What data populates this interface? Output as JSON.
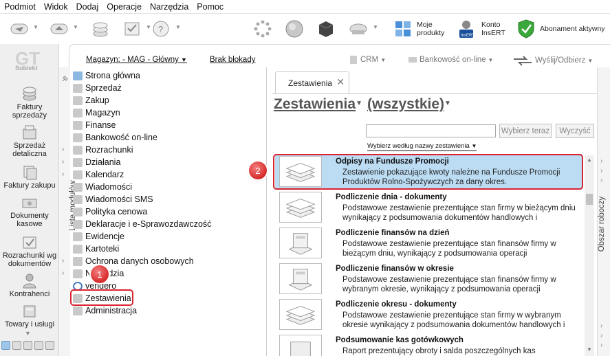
{
  "menu": [
    "Podmiot",
    "Widok",
    "Dodaj",
    "Operacje",
    "Narzędzia",
    "Pomoc"
  ],
  "toolbar": {
    "my_products": "Moje\nprodukty",
    "account": "Konto\nInsERT",
    "subscription": "Abonament aktywny"
  },
  "leftbar": {
    "logo": "Subiekt",
    "items": [
      "Faktury sprzedaży",
      "Sprzedaż detaliczna",
      "Faktury zakupu",
      "Dokumenty kasowe",
      "Rozrachunki wg dokumentów",
      "Kontrahenci",
      "Towary i usługi"
    ]
  },
  "header": {
    "magazyn": "Magazyn: - MAG - Główny",
    "lock": "Brak blokady",
    "crm": "CRM",
    "bank": "Bankowość on-line",
    "send": "Wyślij/Odbierz"
  },
  "modules": {
    "panel_label": "Lista modułów",
    "items": [
      "Strona główna",
      "Sprzedaż",
      "Zakup",
      "Magazyn",
      "Finanse",
      "Bankowość on-line",
      "Rozrachunki",
      "Działania",
      "Kalendarz",
      "Wiadomości",
      "Wiadomości SMS",
      "Polityka cenowa",
      "Deklaracje i e-Sprawozdawczość",
      "Ewidencje",
      "Kartoteki",
      "Ochrona danych osobowych",
      "Narzędzia",
      "vendero",
      "Zestawienia",
      "Administracja"
    ]
  },
  "content": {
    "tab": "Zestawienia",
    "title": "Zestawienia",
    "filter": "(wszystkie)",
    "choose_btn": "Wybierz teraz",
    "clear_btn": "Wyczyść",
    "sort_by": "Wybierz według nazwy zestawienia",
    "right_panel": "Obszar roboczy"
  },
  "reports": [
    {
      "title": "Odpisy na Fundusze Promocji",
      "desc": "Zestawienie pokazujące kwoty należne na Fundusze Promocji Produktów Rolno-Spożywczych za dany okres."
    },
    {
      "title": "Podliczenie dnia - dokumenty",
      "desc": "Podstawowe zestawienie prezentujące stan firmy w bieżącym dniu wynikający z podsumowania dokumentów handlowych i"
    },
    {
      "title": "Podliczenie finansów na dzień",
      "desc": "Podstawowe zestawienie prezentujące stan finansów firmy w bieżącym dniu, wynikający z podsumowania operacji"
    },
    {
      "title": "Podliczenie finansów w okresie",
      "desc": "Podstawowe zestawienie prezentujące stan finansów firmy w wybranym okresie, wynikający z podsumowania operacji"
    },
    {
      "title": "Podliczenie okresu - dokumenty",
      "desc": "Podstawowe zestawienie prezentujące stan firmy w wybranym okresie wynikający z podsumowania dokumentów handlowych i"
    },
    {
      "title": "Podsumowanie kas gotówkowych",
      "desc": "Raport prezentujący obroty i salda poszczególnych kas"
    }
  ],
  "badges": [
    "1",
    "2"
  ]
}
